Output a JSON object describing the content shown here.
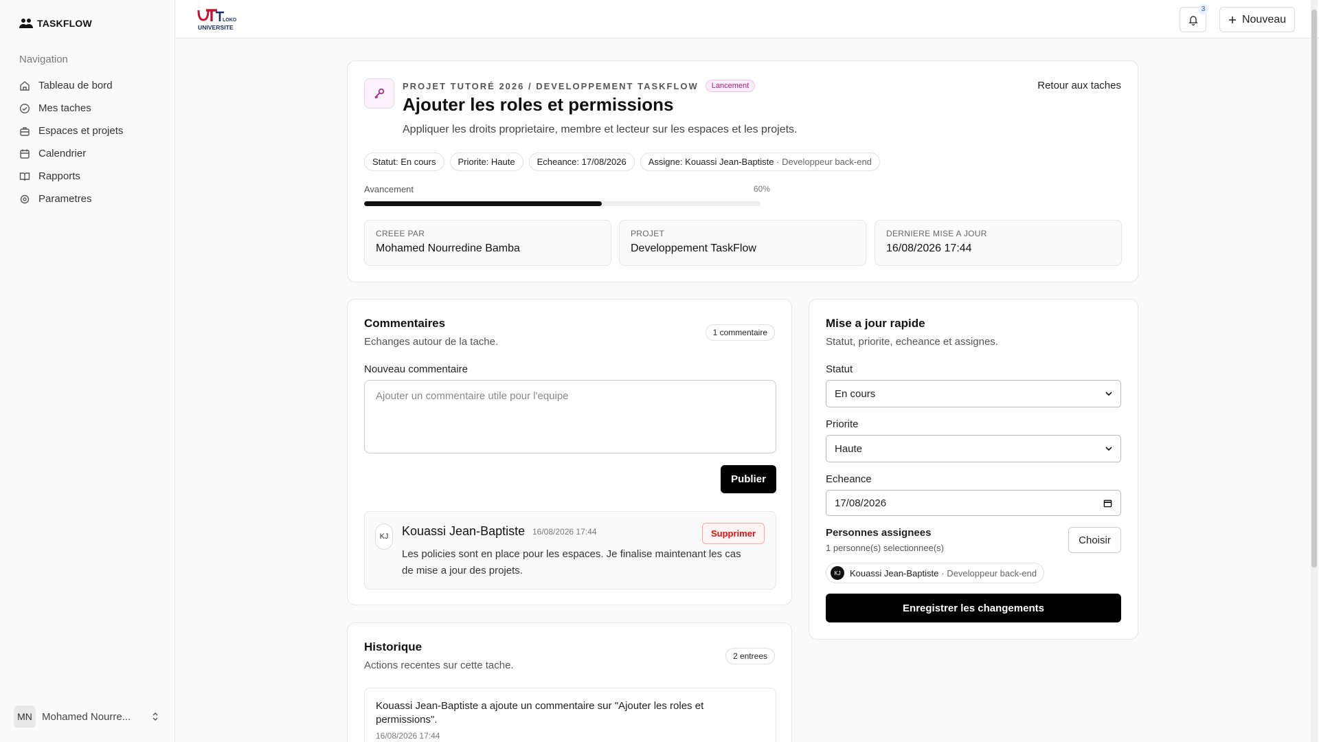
{
  "sidebar": {
    "brand": "TASKFLOW",
    "nav_title": "Navigation",
    "items": [
      {
        "label": "Tableau de bord",
        "icon": "home-icon"
      },
      {
        "label": "Mes taches",
        "icon": "check-circle-icon"
      },
      {
        "label": "Espaces et projets",
        "icon": "briefcase-icon"
      },
      {
        "label": "Calendrier",
        "icon": "calendar-icon"
      },
      {
        "label": "Rapports",
        "icon": "book-open-icon"
      },
      {
        "label": "Parametres",
        "icon": "settings-icon"
      }
    ],
    "user": {
      "initials": "MN",
      "name": "Mohamed Nourre..."
    }
  },
  "topbar": {
    "notification_count": "3",
    "new_button": "Nouveau",
    "logo_text": [
      "UT",
      "LOKO",
      "UNIVERSITE"
    ]
  },
  "task": {
    "breadcrumb": "PROJET TUTORÉ 2026 / DEVELOPPEMENT TASKFLOW",
    "stage": "Lancement",
    "back_link": "Retour aux taches",
    "title": "Ajouter les roles et permissions",
    "description": "Appliquer les droits proprietaire, membre et lecteur sur les espaces et les projets.",
    "chips": {
      "status": "Statut: En cours",
      "priority": "Priorite: Haute",
      "due": "Echeance: 17/08/2026",
      "assignee": "Assigne: Kouassi Jean-Baptiste",
      "assignee_role": "· Developpeur back-end"
    },
    "progress_label": "Avancement",
    "progress_text": "60%",
    "progress_value": 0.6,
    "meta": [
      {
        "label": "CREEE PAR",
        "value": "Mohamed Nourredine Bamba"
      },
      {
        "label": "PROJET",
        "value": "Developpement TaskFlow"
      },
      {
        "label": "DERNIERE MISE A JOUR",
        "value": "16/08/2026 17:44"
      }
    ]
  },
  "comments": {
    "title": "Commentaires",
    "subtitle": "Echanges autour de la tache.",
    "count": "1 commentaire",
    "new_label": "Nouveau commentaire",
    "placeholder": "Ajouter un commentaire utile pour l'equipe",
    "publish": "Publier",
    "items": [
      {
        "initials": "KJ",
        "author": "Kouassi Jean-Baptiste",
        "date": "16/08/2026 17:44",
        "delete": "Supprimer",
        "body": "Les policies sont en place pour les espaces. Je finalise maintenant les cas de mise a jour des projets."
      }
    ]
  },
  "history": {
    "title": "Historique",
    "subtitle": "Actions recentes sur cette tache.",
    "count": "2 entrees",
    "items": [
      {
        "text": "Kouassi Jean-Baptiste a ajoute un commentaire sur \"Ajouter les roles et permissions\".",
        "date": "16/08/2026 17:44"
      }
    ]
  },
  "quick_update": {
    "title": "Mise a jour rapide",
    "subtitle": "Statut, priorite, echeance et assignes.",
    "status_label": "Statut",
    "status_value": "En cours",
    "priority_label": "Priorite",
    "priority_value": "Haute",
    "due_label": "Echeance",
    "due_value": "17/08/2026",
    "assigned_label": "Personnes assignees",
    "assigned_count": "1 personne(s) selectionnee(s)",
    "choose": "Choisir",
    "assignee_initials": "KJ",
    "assignee_name": "Kouassi Jean-Baptiste",
    "assignee_role": "· Developpeur back-end",
    "save": "Enregistrer les changements"
  },
  "colors": {
    "accent": "#a3208a",
    "danger": "#dd1111",
    "primary": "#000000"
  }
}
